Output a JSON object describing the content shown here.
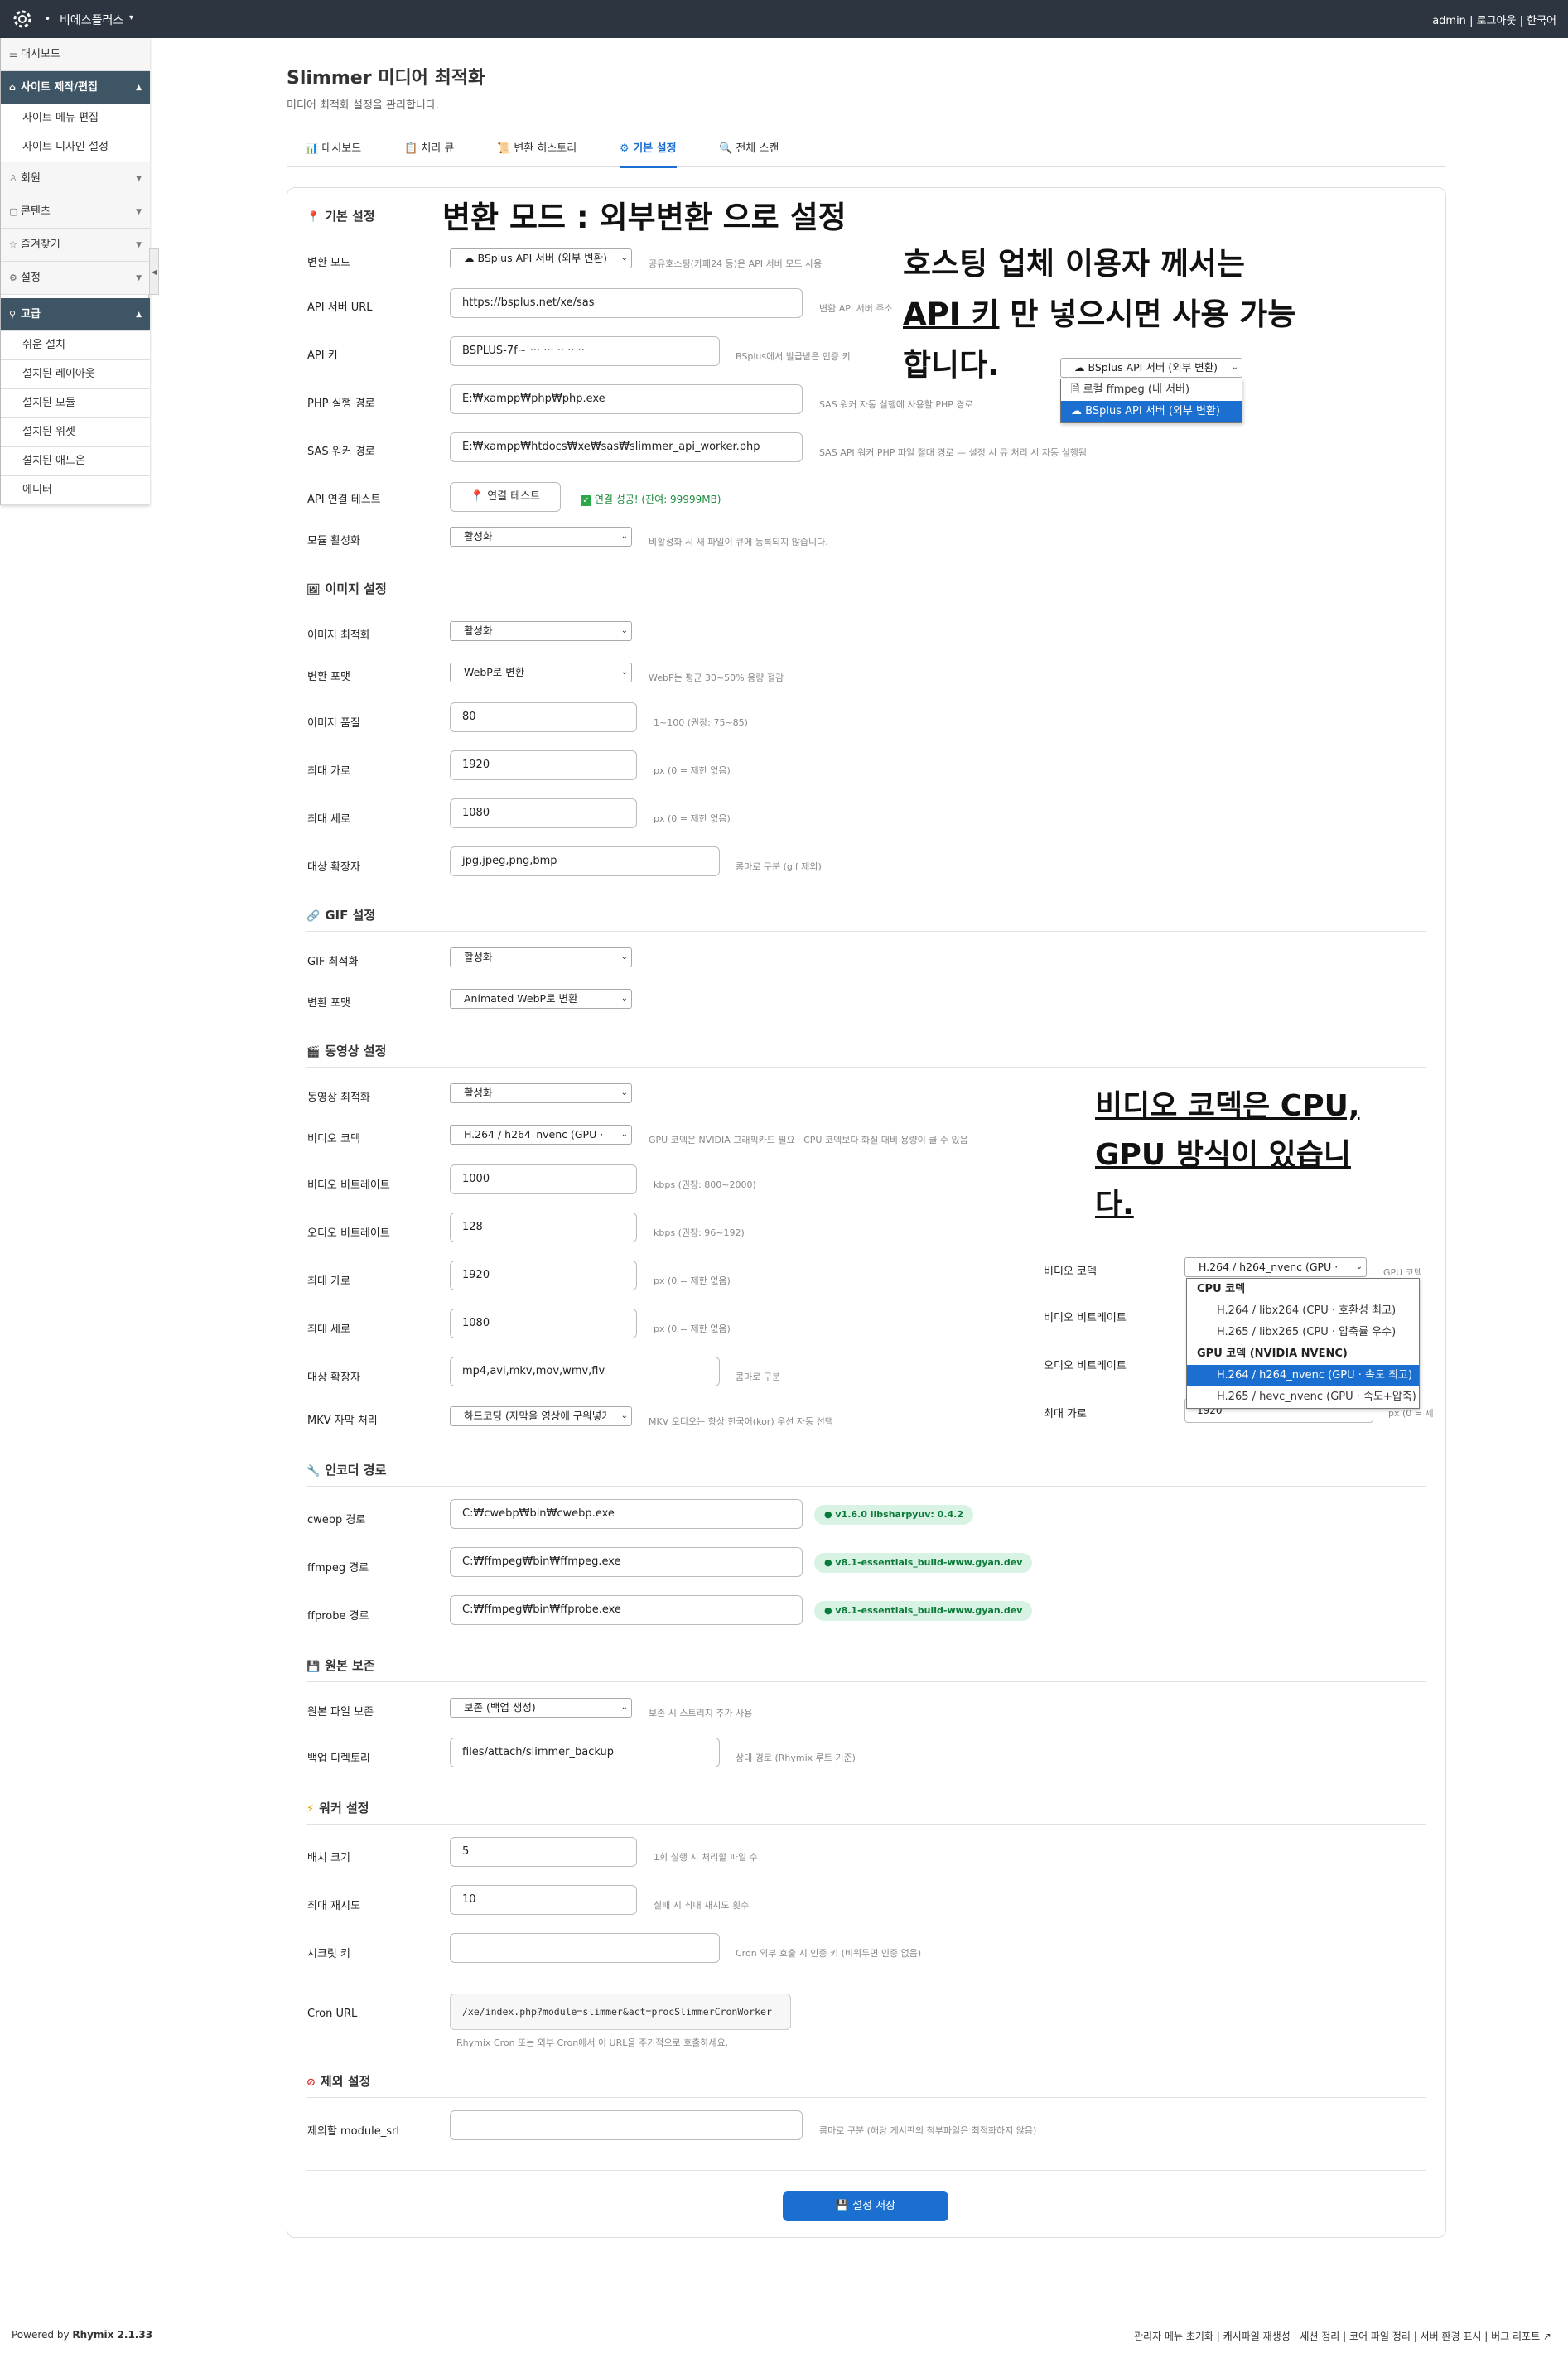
{
  "topbar": {
    "site_name": "비에스플러스",
    "dot": "•",
    "caret": "▾",
    "user": "admin",
    "logout": "로그아웃",
    "language": "한국어",
    "sep": "|"
  },
  "sidebar": {
    "dashboard": "대시보드",
    "site_group": "사이트 제작/편집",
    "site_items": [
      "사이트 메뉴 편집",
      "사이트 디자인 설정"
    ],
    "members": "회원",
    "contents": "콘텐츠",
    "favorites": "즐겨찾기",
    "settings": "설정",
    "advanced": "고급",
    "advanced_items": [
      "쉬운 설치",
      "설치된 레이아웃",
      "설치된 모듈",
      "설치된 위젯",
      "설치된 애드온",
      "에디터"
    ]
  },
  "page": {
    "title": "Slimmer 미디어 최적화",
    "desc": "미디어 최적화 설정을 관리합니다."
  },
  "tabs": [
    "대시보드",
    "처리 큐",
    "변환 히스토리",
    "기본 설정",
    "전체 스캔"
  ],
  "basic": {
    "section": "기본 설정",
    "mode_label": "변환 모드",
    "mode_value": "BSplus API 서버 (외부 변환)",
    "mode_hint": "공유호스팅(카페24 등)은 API 서버 모드 사용",
    "api_url_label": "API 서버 URL",
    "api_url_value": "https://bsplus.net/xe/sas",
    "api_url_hint": "변환 API 서버 주소",
    "api_key_label": "API 키",
    "api_key_value": "BSPLUS-7f~ ··· ··· ·· ·· ··",
    "api_key_hint": "BSplus에서 발급받은 인증 키",
    "php_label": "PHP 실행 경로",
    "php_value": "E:₩xampp₩php₩php.exe",
    "php_hint": "SAS 워커 자동 실행에 사용할 PHP 경로",
    "sas_label": "SAS 워커 경로",
    "sas_value": "E:₩xampp₩htdocs₩xe₩sas₩slimmer_api_worker.php",
    "sas_hint": "SAS API 워커 PHP 파일 절대 경로 — 설정 시 큐 처리 시 자동 실행됨",
    "test_label": "API 연결 테스트",
    "test_button": "연결 테스트",
    "test_result": "연결 성공! (잔여: 99999MB)",
    "module_label": "모듈 활성화",
    "module_value": "활성화",
    "module_hint": "비활성화 시 새 파일이 큐에 등록되지 않습니다."
  },
  "image": {
    "section": "이미지 설정",
    "opt_label": "이미지 최적화",
    "opt_value": "활성화",
    "fmt_label": "변환 포맷",
    "fmt_value": "WebP로 변환",
    "fmt_hint": "WebP는 평균 30~50% 용량 절감",
    "q_label": "이미지 품질",
    "q_value": "80",
    "q_hint": "1~100 (권장: 75~85)",
    "w_label": "최대 가로",
    "w_value": "1920",
    "w_hint": "px (0 = 제한 없음)",
    "h_label": "최대 세로",
    "h_value": "1080",
    "h_hint": "px (0 = 제한 없음)",
    "ext_label": "대상 확장자",
    "ext_value": "jpg,jpeg,png,bmp",
    "ext_hint": "콤마로 구분 (gif 제외)"
  },
  "gif": {
    "section": "GIF 설정",
    "opt_label": "GIF 최적화",
    "opt_value": "활성화",
    "fmt_label": "변환 포맷",
    "fmt_value": "Animated WebP로 변환"
  },
  "video": {
    "section": "동영상 설정",
    "opt_label": "동영상 최적화",
    "opt_value": "활성화",
    "codec_label": "비디오 코덱",
    "codec_value": "H.264 / h264_nvenc (GPU · 속도 최고)",
    "codec_hint": "GPU 코덱은 NVIDIA 그래픽카드 필요 · CPU 코덱보다 화질 대비 용량이 클 수 있음",
    "vb_label": "비디오 비트레이트",
    "vb_value": "1000",
    "vb_hint": "kbps (권장: 800~2000)",
    "ab_label": "오디오 비트레이트",
    "ab_value": "128",
    "ab_hint": "kbps (권장: 96~192)",
    "w_label": "최대 가로",
    "w_value": "1920",
    "w_hint": "px (0 = 제한 없음)",
    "h_label": "최대 세로",
    "h_value": "1080",
    "h_hint": "px (0 = 제한 없음)",
    "ext_label": "대상 확장자",
    "ext_value": "mp4,avi,mkv,mov,wmv,flv",
    "ext_hint": "콤마로 구분",
    "mkv_label": "MKV 자막 처리",
    "mkv_value": "하드코딩 (자막을 영상에 구워넣기)",
    "mkv_hint": "MKV 오디오는 항상 한국어(kor) 우선 자동 선택"
  },
  "encoder": {
    "section": "인코더 경로",
    "cwebp_label": "cwebp 경로",
    "cwebp_value": "C:₩cwebp₩bin₩cwebp.exe",
    "cwebp_badge": "● v1.6.0 libsharpyuv: 0.4.2",
    "ffmpeg_label": "ffmpeg 경로",
    "ffmpeg_value": "C:₩ffmpeg₩bin₩ffmpeg.exe",
    "ffmpeg_badge": "● v8.1-essentials_build-www.gyan.dev",
    "ffprobe_label": "ffprobe 경로",
    "ffprobe_value": "C:₩ffmpeg₩bin₩ffprobe.exe",
    "ffprobe_badge": "● v8.1-essentials_build-www.gyan.dev"
  },
  "original": {
    "section": "원본 보존",
    "keep_label": "원본 파일 보존",
    "keep_value": "보존 (백업 생성)",
    "keep_hint": "보존 시 스토리지 추가 사용",
    "dir_label": "백업 디렉토리",
    "dir_value": "files/attach/slimmer_backup",
    "dir_hint": "상대 경로 (Rhymix 루트 기준)"
  },
  "worker": {
    "section": "워커 설정",
    "batch_label": "배치 크기",
    "batch_value": "5",
    "batch_hint": "1회 실행 시 처리할 파일 수",
    "retry_label": "최대 재시도",
    "retry_value": "10",
    "retry_hint": "실패 시 최대 재시도 횟수",
    "secret_label": "시크릿 키",
    "secret_value": "",
    "secret_hint": "Cron 외부 호출 시 인증 키 (비워두면 인증 없음)",
    "cron_label": "Cron URL",
    "cron_value": "/xe/index.php?module=slimmer&act=procSlimmerCronWorker",
    "cron_hint": "Rhymix Cron 또는 외부 Cron에서 이 URL을 주기적으로 호출하세요."
  },
  "exclude": {
    "section": "제외 설정",
    "label": "제외할 module_srl",
    "value": "",
    "hint": "콤마로 구분 (해당 게시판의 첨부파일은 최적화하지 않음)"
  },
  "save_button": "설정 저장",
  "annotations": {
    "mode": "변환 모드 : 외부변환 으로 설정",
    "hosting_l1": "호스팅 업체 이용자 께서는",
    "hosting_l2a": "API 키",
    "hosting_l2b": " 만 넣으시면 사용 가능",
    "hosting_l3": "합니다.",
    "codec_l1": "비디오 코덱은 CPU,",
    "codec_l2": "GPU 방식이 있습니",
    "codec_l3": "다."
  },
  "mode_popup": {
    "select_value": "BSplus API 서버 (외부 변환)",
    "options": [
      "로컬 ffmpeg (내 서버)",
      "BSplus API 서버 (외부 변환)"
    ]
  },
  "codec_popup": {
    "select_value": "H.264 / h264_nvenc (GPU · 속도 최고)",
    "labels": [
      "비디오 코덱",
      "비디오 비트레이트",
      "오디오 비트레이트",
      "최대 가로"
    ],
    "side_hint": "GPU 코덱",
    "group_cpu": "CPU 코덱",
    "cpu_options": [
      "H.264 / libx264 (CPU · 호환성 최고)",
      "H.265 / libx265 (CPU · 압축률 우수)"
    ],
    "group_gpu": "GPU 코덱 (NVIDIA NVENC)",
    "gpu_options": [
      "H.264 / h264_nvenc (GPU · 속도 최고)",
      "H.265 / hevc_nvenc (GPU · 속도+압축)"
    ],
    "width_value": "1920",
    "px_hint": "px (0 = 제"
  },
  "footer": {
    "powered": "Powered by",
    "engine": "Rhymix 2.1.33",
    "links": "관리자 메뉴 초기화 | 캐시파일 재생성 | 세션 정리 | 코어 파일 정리 | 서버 환경 표시 | 버그 리포트 ↗"
  },
  "colors": {
    "accent": "#1a6fd1",
    "topbar": "#2d3640",
    "sidebar_active": "#3e5565",
    "badge_bg": "#d8f3e3"
  }
}
